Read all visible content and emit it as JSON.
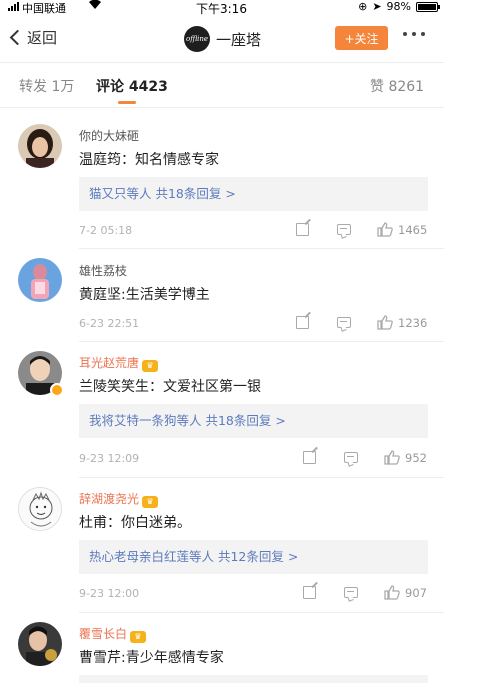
{
  "status_bar": {
    "carrier": "中国联通",
    "time": "下午3:16",
    "battery": "98%",
    "battery_level": 0.98
  },
  "nav": {
    "back_label": "返回",
    "logo_text": "offline",
    "account_name": "一座塔",
    "follow_label": "+关注"
  },
  "tabs": {
    "repost": "转发 1万",
    "comments": "评论 4423",
    "likes": "赞 8261"
  },
  "comments": [
    {
      "username": "你的大妹砸",
      "vip": false,
      "text": "温庭筠：知名情感专家",
      "replies": "猫又只等人  共18条回复 >",
      "time": "7-2 05:18",
      "likes": "1465"
    },
    {
      "username": "雄性荔枝",
      "vip": false,
      "text": "黄庭坚:生活美学博主",
      "replies": "",
      "time": "6-23 22:51",
      "likes": "1236"
    },
    {
      "username": "耳光赵荒唐",
      "vip": true,
      "text": "兰陵笑笑生：文爱社区第一银",
      "replies": "我将艾特一条狗等人  共18条回复 >",
      "time": "9-23 12:09",
      "likes": "952"
    },
    {
      "username": "辞湖渡尧光",
      "vip": true,
      "text": "杜甫：你白迷弟。",
      "replies": "热心老母亲白红莲等人  共12条回复 >",
      "time": "9-23 12:00",
      "likes": "907"
    },
    {
      "username": "覆雪长白",
      "vip": true,
      "text": "曹雪芹:青少年感情专家",
      "replies": "",
      "time": "",
      "likes": ""
    }
  ],
  "colors": {
    "accent": "#f5853a",
    "vip_name": "#eb7350",
    "reply_link": "#5d7bbd"
  }
}
